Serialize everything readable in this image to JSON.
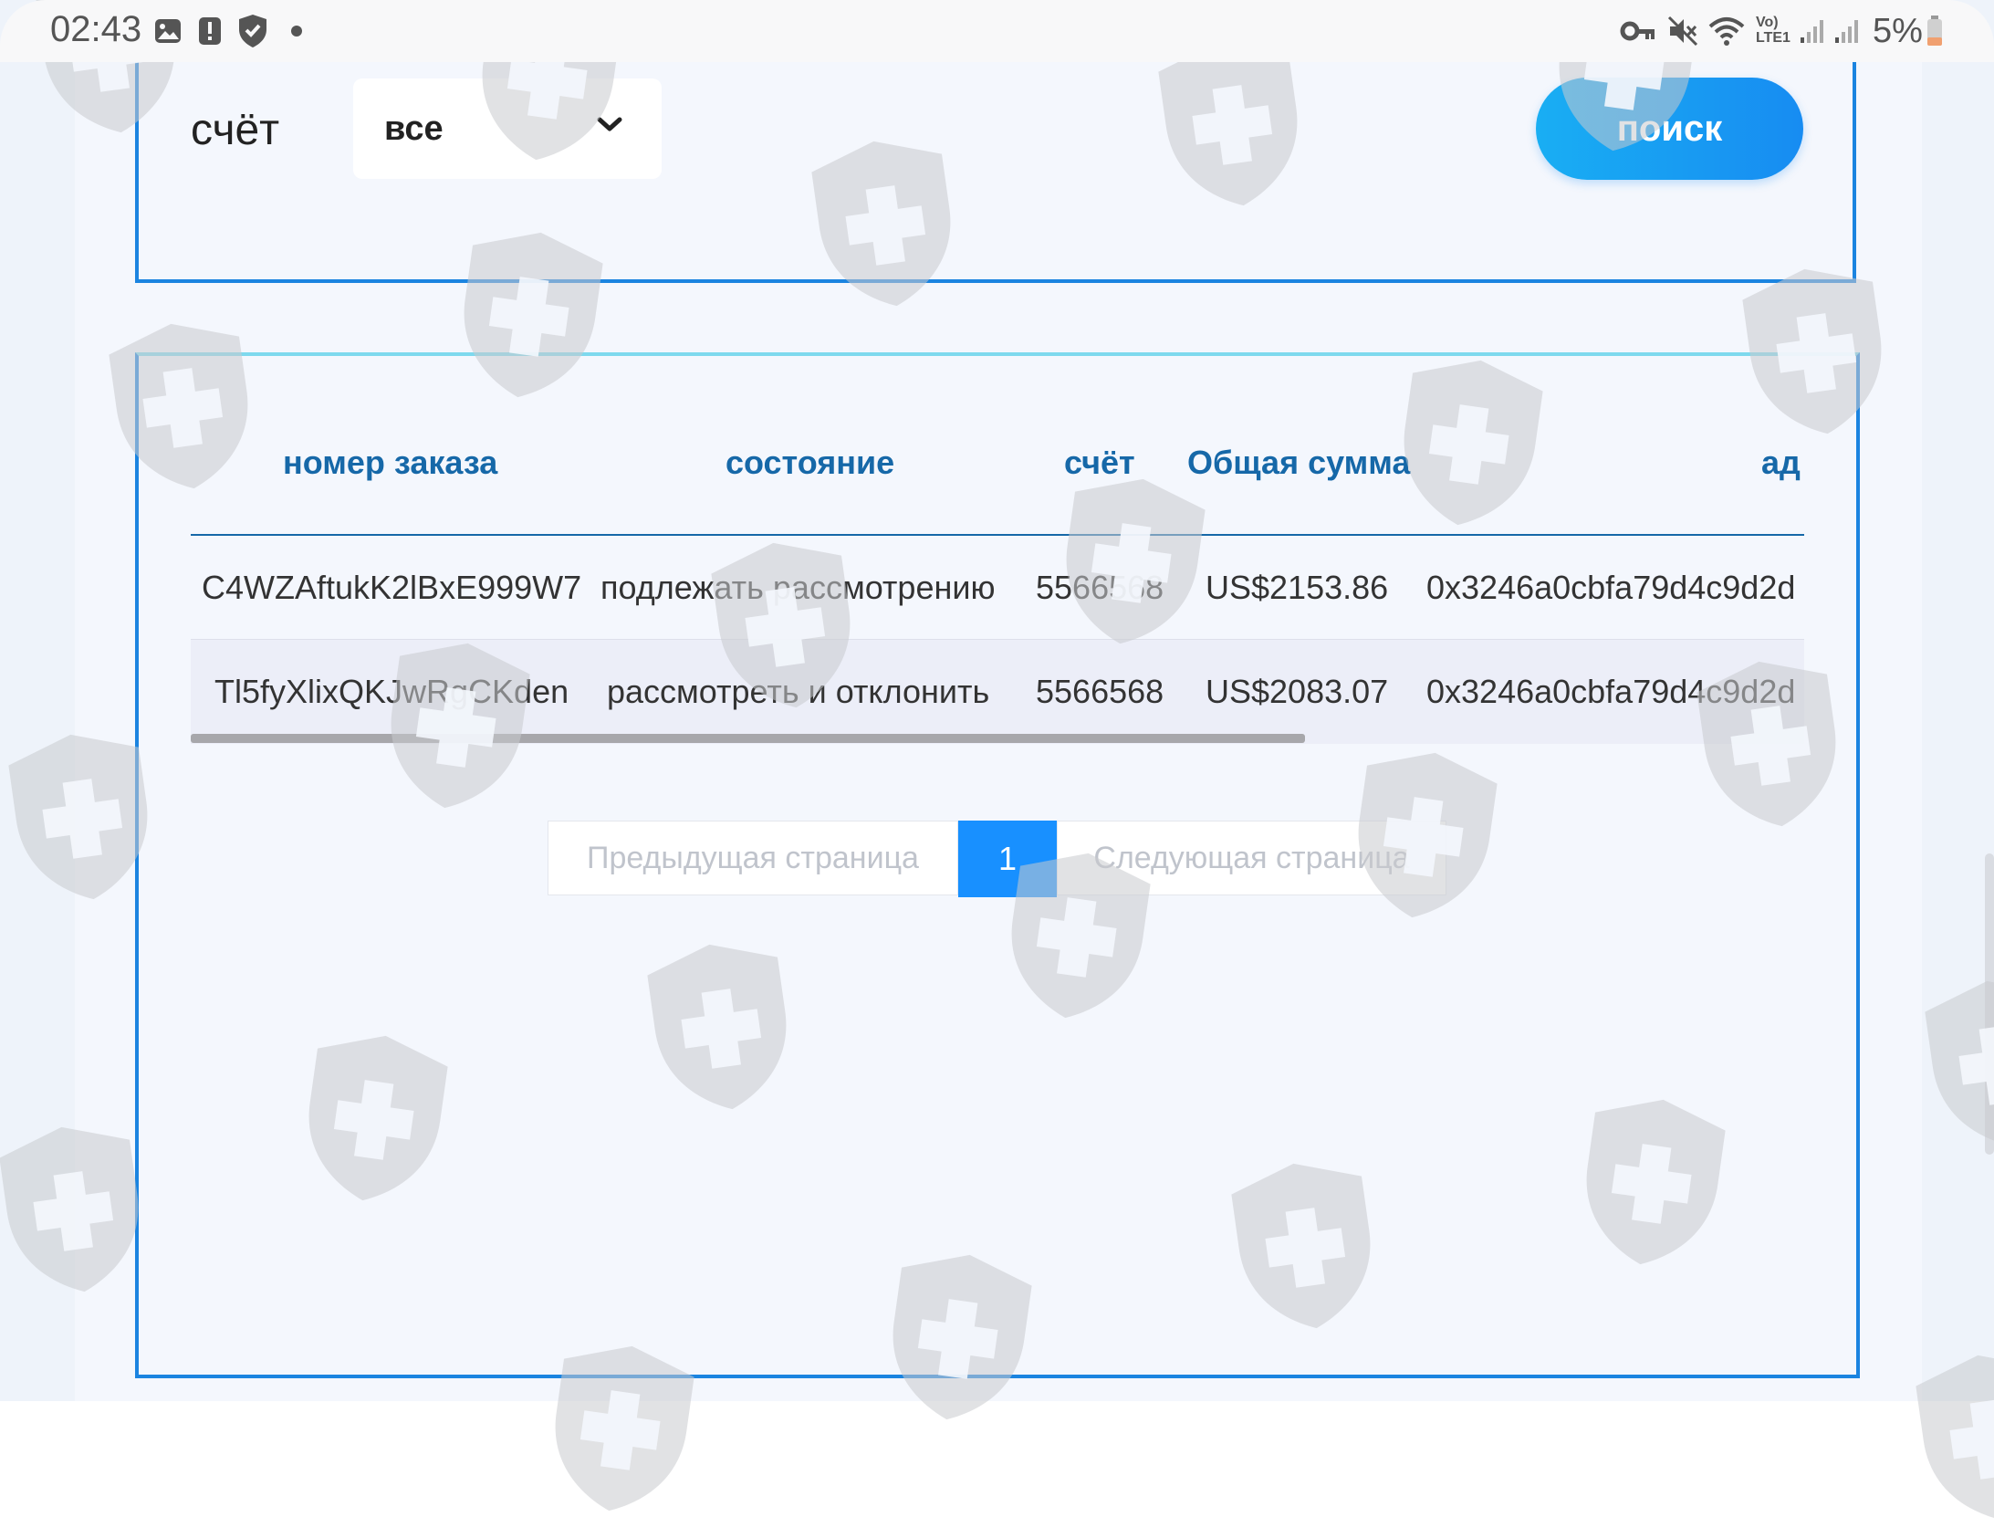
{
  "status_bar": {
    "time": "02:43",
    "battery": "5%",
    "lte_top": "Vo)",
    "lte_bottom": "LTE1",
    "icons": [
      "gallery-icon",
      "alert-icon",
      "shield-check-icon",
      "dot-icon",
      "key-icon",
      "mute-icon",
      "wifi-icon",
      "signal-icon",
      "battery-icon"
    ]
  },
  "filter": {
    "label": "счёт",
    "select_value": "все",
    "search_label": "поиск"
  },
  "table": {
    "columns": [
      "номер заказа",
      "состояние",
      "счёт",
      "Общая сумма",
      "ад"
    ],
    "rows": [
      {
        "order": "C4WZAftukK2lBxE999W7",
        "status": "подлежать рассмотрению",
        "account": "5566568",
        "amount": "US$2153.86",
        "address": "0x3246a0cbfa79d4c9d2d"
      },
      {
        "order": "Tl5fyXlixQKJwRgCKden",
        "status": "рассмотреть и отклонить",
        "account": "5566568",
        "amount": "US$2083.07",
        "address": "0x3246a0cbfa79d4c9d2d"
      }
    ]
  },
  "pagination": {
    "prev": "Предыдущая страница",
    "current": "1",
    "next": "Следующая страница"
  },
  "colors": {
    "accent": "#178cf2",
    "header_text": "#1668a8",
    "panel_border": "#1b84e0",
    "watermark": "#c8cacd"
  }
}
